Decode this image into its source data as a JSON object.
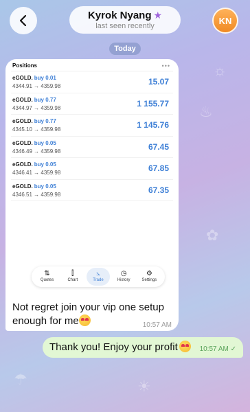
{
  "header": {
    "back_icon": "chevron-left-icon",
    "contact_name": "Kyrok Nyang",
    "badge_icon": "star-icon",
    "badge_color": "#a064dc",
    "status": "last seen recently",
    "avatar_initials": "KN"
  },
  "date_separator": "Today",
  "screenshot": {
    "title": "Positions",
    "menu": "•••",
    "positions": [
      {
        "symbol": "eGOLD.",
        "action": "buy 0.01",
        "open": "4344.91",
        "arrow": "→",
        "close": "4359.98",
        "profit": "15.07"
      },
      {
        "symbol": "eGOLD.",
        "action": "buy 0.77",
        "open": "4344.97",
        "arrow": "→",
        "close": "4359.98",
        "profit": "1 155.77"
      },
      {
        "symbol": "eGOLD.",
        "action": "buy 0.77",
        "open": "4345.10",
        "arrow": "→",
        "close": "4359.98",
        "profit": "1 145.76"
      },
      {
        "symbol": "eGOLD.",
        "action": "buy 0.05",
        "open": "4346.49",
        "arrow": "→",
        "close": "4359.98",
        "profit": "67.45"
      },
      {
        "symbol": "eGOLD.",
        "action": "buy 0.05",
        "open": "4346.41",
        "arrow": "→",
        "close": "4359.98",
        "profit": "67.85"
      },
      {
        "symbol": "eGOLD.",
        "action": "buy 0.05",
        "open": "4346.51",
        "arrow": "→",
        "close": "4359.98",
        "profit": "67.35"
      }
    ],
    "tabs": [
      {
        "label": "Quotes",
        "icon": "quotes-icon",
        "glyph": "⇅"
      },
      {
        "label": "Chart",
        "icon": "candles-icon",
        "glyph": "⫿"
      },
      {
        "label": "Trade",
        "icon": "trade-icon",
        "glyph": "⦣"
      },
      {
        "label": "History",
        "icon": "history-icon",
        "glyph": "◷"
      },
      {
        "label": "Settings",
        "icon": "settings-icon",
        "glyph": "⚙"
      }
    ],
    "active_tab": "Trade"
  },
  "messages": {
    "incoming_text": "Not regret join your vip one setup enough for me",
    "incoming_time": "10:57 AM",
    "outgoing_text": "Thank you! Enjoy your profit",
    "outgoing_time": "10:57 AM",
    "read_icon": "check-icon"
  },
  "colors": {
    "accent_blue": "#3d7fd6",
    "outgoing_bubble": "#e2f7d4",
    "avatar": "#f08a24"
  }
}
